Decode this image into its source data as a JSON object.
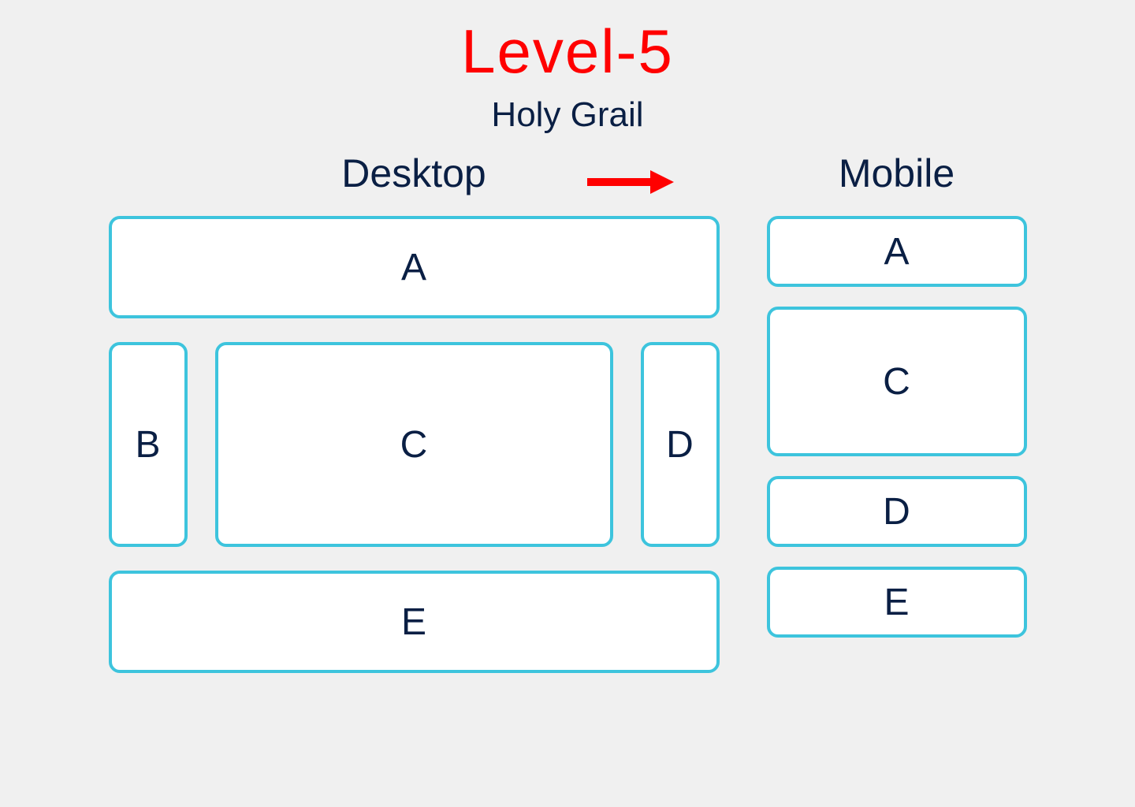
{
  "title": "Level-5",
  "subtitle": "Holy Grail",
  "desktop": {
    "label": "Desktop",
    "boxes": {
      "a": "A",
      "b": "B",
      "c": "C",
      "d": "D",
      "e": "E"
    }
  },
  "mobile": {
    "label": "Mobile",
    "boxes": {
      "a": "A",
      "c": "C",
      "d": "D",
      "e": "E"
    }
  },
  "colors": {
    "title": "#ff0000",
    "text": "#0a1f44",
    "border": "#3dc4dd",
    "background": "#f0f0f0",
    "box_bg": "#ffffff",
    "arrow": "#ff0000"
  }
}
